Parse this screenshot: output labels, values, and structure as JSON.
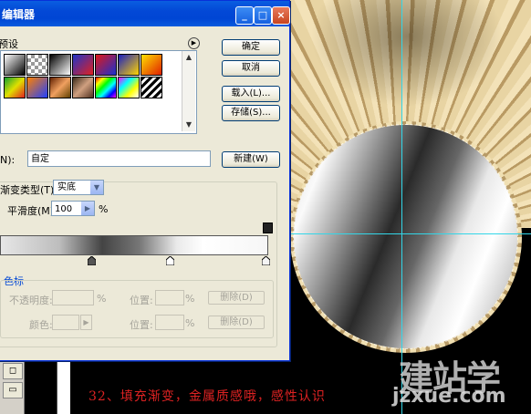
{
  "dialog": {
    "title": "编辑器",
    "presets_label": "预设",
    "buttons": {
      "ok": "确定",
      "cancel": "取消",
      "load": "载入(L)...",
      "save": "存储(S)...",
      "new": "新建(W)"
    },
    "name_label": "N):",
    "name_value": "自定",
    "gradient_type_label": "渐变类型(T):",
    "gradient_type_value": "实底",
    "smoothness_label": "平滑度(M):",
    "smoothness_value": "100",
    "smoothness_unit": "%",
    "stops_section_label": "色标",
    "opacity_label": "不透明度:",
    "opacity_unit": "%",
    "location_label": "位置:",
    "location_unit": "%",
    "delete_label": "删除(D)",
    "color_label": "颜色:"
  },
  "caption": "32、填充渐变，金属质感哦，感性认识",
  "watermark": {
    "text": "建站学",
    "url": "jzxue.com"
  },
  "colors": {
    "titlebar": "#0348d6",
    "caption": "#dd2222",
    "guide": "#33d6e8"
  }
}
